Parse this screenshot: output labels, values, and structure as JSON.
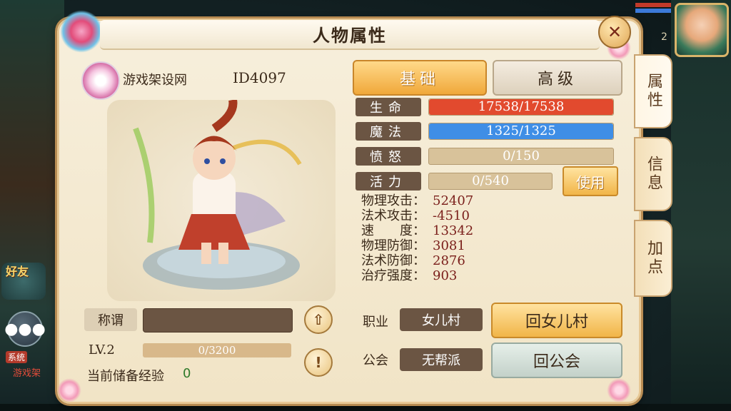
{
  "window": {
    "title": "人物属性",
    "close_icon": "close-icon"
  },
  "side_tabs": [
    {
      "label": "属性",
      "active": true
    },
    {
      "label": "信息",
      "active": false
    },
    {
      "label": "加点",
      "active": false
    }
  ],
  "background": {
    "friends_label": "好友",
    "system_tag": "系统",
    "system_text": "游戏架",
    "top_right_level": "2"
  },
  "player": {
    "name": "游戏架设网",
    "id": "ID4097",
    "title_label": "称谓",
    "title_value": "",
    "level": "LV.2",
    "exp": {
      "current": 0,
      "max": 3200,
      "text": "0/3200"
    },
    "reserve_label": "当前储备经验",
    "reserve_value": "0"
  },
  "tabs": {
    "basic": "基础",
    "advanced": "高级"
  },
  "stats": {
    "hp": {
      "label": "生命",
      "text": "17538/17538",
      "current": 17538,
      "max": 17538,
      "color": "#e24a2e"
    },
    "mp": {
      "label": "魔法",
      "text": "1325/1325",
      "current": 1325,
      "max": 1325,
      "color": "#3f8ee6"
    },
    "rage": {
      "label": "愤怒",
      "text": "0/150",
      "current": 0,
      "max": 150
    },
    "vigor": {
      "label": "活力",
      "text": "0/540",
      "current": 0,
      "max": 540
    },
    "use_button": "使用"
  },
  "attributes": [
    {
      "key": "物理攻击：",
      "value": "52407"
    },
    {
      "key": "法术攻击：",
      "value": "-4510"
    },
    {
      "key": "速　　度：",
      "value": "13342"
    },
    {
      "key": "物理防御：",
      "value": "3081"
    },
    {
      "key": "法术防御：",
      "value": "2876"
    },
    {
      "key": "治疗强度：",
      "value": "903"
    }
  ],
  "job": {
    "label": "职业",
    "value": "女儿村",
    "button": "回女儿村"
  },
  "guild": {
    "label": "公会",
    "value": "无帮派",
    "button": "回公会"
  },
  "icons": {
    "upload": "upload-icon",
    "info": "exclamation-icon",
    "chat": "chat-bubble-icon"
  }
}
